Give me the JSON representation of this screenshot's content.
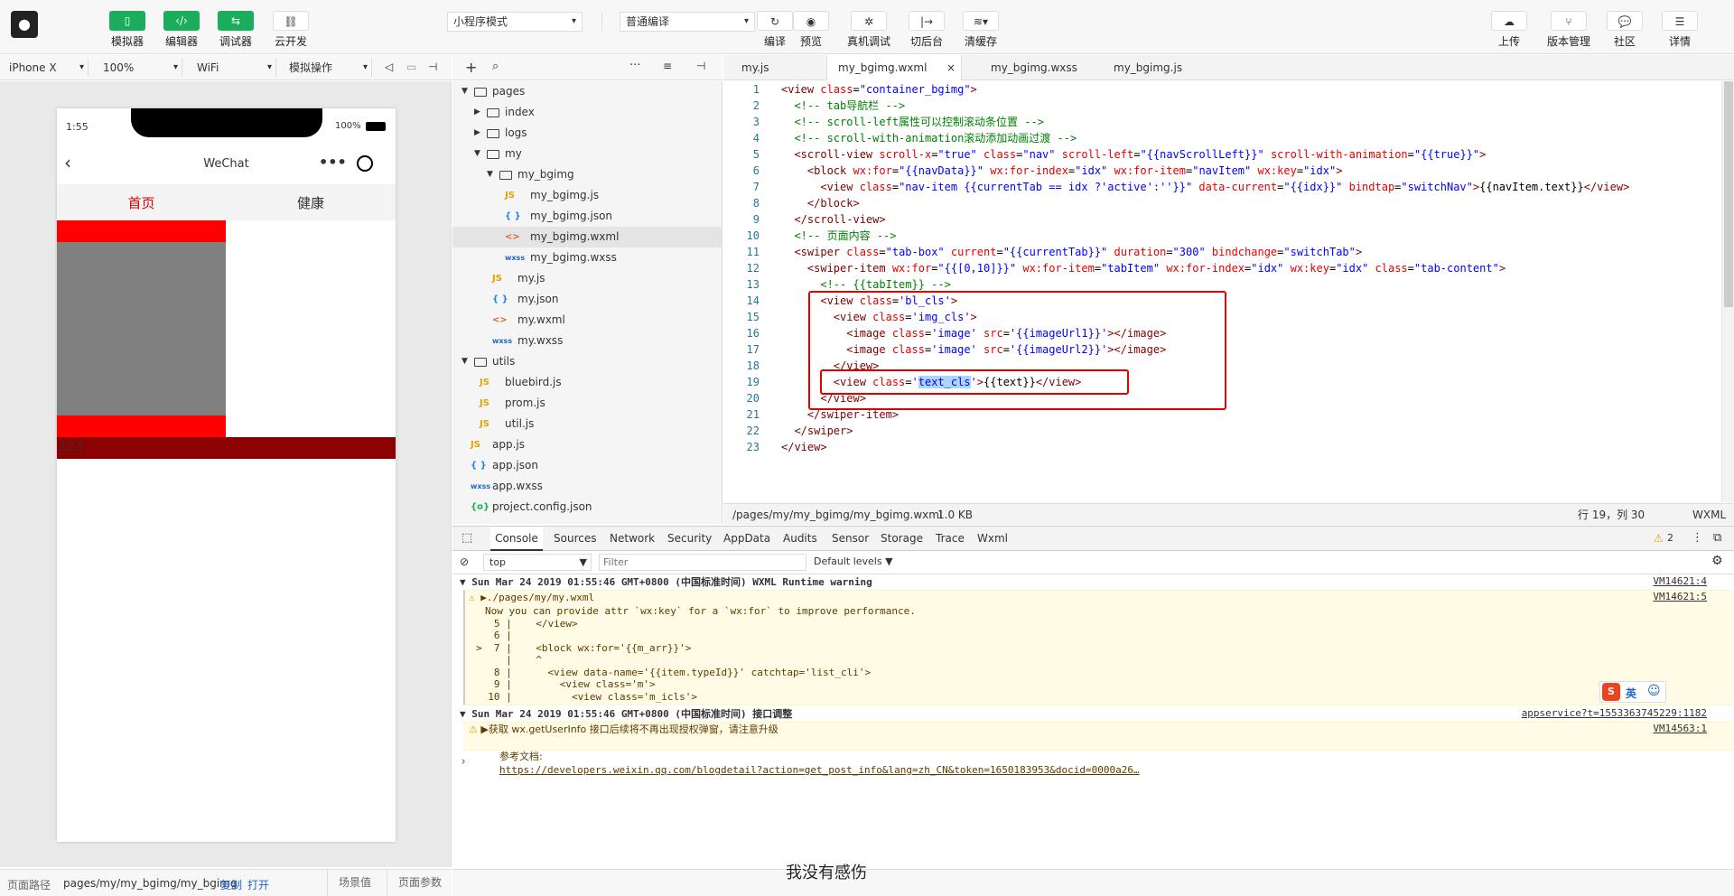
{
  "toolbar": {
    "buttons_left": [
      {
        "label": "模拟器",
        "icon": "phone-icon"
      },
      {
        "label": "编辑器",
        "icon": "code-icon"
      },
      {
        "label": "调试器",
        "icon": "debug-icon"
      },
      {
        "label": "云开发",
        "icon": "cloud-link-icon"
      }
    ],
    "mode_select": "小程序模式",
    "compile_select": "普通编译",
    "buttons_mid": [
      {
        "label": "编译",
        "icon": "refresh-icon"
      },
      {
        "label": "预览",
        "icon": "eye-icon"
      },
      {
        "label": "真机调试",
        "icon": "bug-icon"
      },
      {
        "label": "切后台",
        "icon": "switch-icon"
      },
      {
        "label": "清缓存",
        "icon": "layers-icon"
      }
    ],
    "buttons_right": [
      {
        "label": "上传",
        "icon": "upload-icon"
      },
      {
        "label": "版本管理",
        "icon": "version-icon"
      },
      {
        "label": "社区",
        "icon": "chat-icon"
      },
      {
        "label": "详情",
        "icon": "menu-icon"
      }
    ]
  },
  "simulator": {
    "device": "iPhone X",
    "zoom": "100%",
    "network": "WiFi",
    "operation": "模拟操作",
    "time": "1:55",
    "battery": "100%",
    "nav_title": "WeChat",
    "tabs": [
      "首页",
      "健康"
    ],
    "content_text": "123"
  },
  "footer_left": {
    "path_label": "页面路径",
    "path": "pages/my/my_bgimg/my_bgimg",
    "copy": "复制",
    "open": "打开",
    "scene": "场景值",
    "params": "页面参数"
  },
  "subtitle": "我没有感伤",
  "tree": [
    {
      "name": "pages",
      "type": "folder",
      "depth": 0,
      "open": true
    },
    {
      "name": "index",
      "type": "folder",
      "depth": 1,
      "open": false
    },
    {
      "name": "logs",
      "type": "folder",
      "depth": 1,
      "open": false
    },
    {
      "name": "my",
      "type": "folder",
      "depth": 1,
      "open": true
    },
    {
      "name": "my_bgimg",
      "type": "folder",
      "depth": 2,
      "open": true
    },
    {
      "name": "my_bgimg.js",
      "type": "js",
      "depth": 3
    },
    {
      "name": "my_bgimg.json",
      "type": "json",
      "depth": 3
    },
    {
      "name": "my_bgimg.wxml",
      "type": "wxml",
      "depth": 3,
      "selected": true
    },
    {
      "name": "my_bgimg.wxss",
      "type": "wxss",
      "depth": 3
    },
    {
      "name": "my.js",
      "type": "js",
      "depth": 2
    },
    {
      "name": "my.json",
      "type": "json",
      "depth": 2
    },
    {
      "name": "my.wxml",
      "type": "wxml",
      "depth": 2
    },
    {
      "name": "my.wxss",
      "type": "wxss",
      "depth": 2
    },
    {
      "name": "utils",
      "type": "folder",
      "depth": 0,
      "open": true
    },
    {
      "name": "bluebird.js",
      "type": "js",
      "depth": 1
    },
    {
      "name": "prom.js",
      "type": "js",
      "depth": 1
    },
    {
      "name": "util.js",
      "type": "js",
      "depth": 1
    },
    {
      "name": "app.js",
      "type": "js",
      "depth": 0
    },
    {
      "name": "app.json",
      "type": "json",
      "depth": 0
    },
    {
      "name": "app.wxss",
      "type": "wxss",
      "depth": 0
    },
    {
      "name": "project.config.json",
      "type": "cfg",
      "depth": 0
    }
  ],
  "editor_tabs": [
    "my.js",
    "my_bgimg.wxml",
    "my_bgimg.wxss",
    "my_bgimg.js"
  ],
  "code_lines": [
    "<view class=\"container_bgimg\">",
    "  <!-- tab导航栏 -->",
    "  <!-- scroll-left属性可以控制滚动条位置 -->",
    "  <!-- scroll-with-animation滚动添加动画过渡 -->",
    "  <scroll-view scroll-x=\"true\" class=\"nav\" scroll-left=\"{{navScrollLeft}}\" scroll-with-animation=\"{{true}}\">",
    "    <block wx:for=\"{{navData}}\" wx:for-index=\"idx\" wx:for-item=\"navItem\" wx:key=\"idx\">",
    "      <view class=\"nav-item {{currentTab == idx ?'active':''}}\" data-current=\"{{idx}}\" bindtap=\"switchNav\">{{navItem.text}}</view>",
    "    </block>",
    "  </scroll-view>",
    "  <!-- 页面内容 -->",
    "  <swiper class=\"tab-box\" current=\"{{currentTab}}\" duration=\"300\" bindchange=\"switchTab\">",
    "    <swiper-item wx:for=\"{{[0,10]}}\" wx:for-item=\"tabItem\" wx:for-index=\"idx\" wx:key=\"idx\" class=\"tab-content\">",
    "      <!-- {{tabItem}} -->",
    "      <view class='bl_cls'>",
    "        <view class='img_cls'>",
    "          <image class='image' src='{{imageUrl1}}'></image>",
    "          <image class='image' src='{{imageUrl2}}'></image>",
    "        </view>",
    "        <view class='text_cls'>{{text}}</view>",
    "      </view>",
    "    </swiper-item>",
    "  </swiper>",
    "</view>"
  ],
  "status": {
    "path": "/pages/my/my_bgimg/my_bgimg.wxml",
    "size": "1.0 KB",
    "cursor": "行 19，列 30",
    "lang": "WXML"
  },
  "devtools_tabs": [
    "Console",
    "Sources",
    "Network",
    "Security",
    "AppData",
    "Audits",
    "Sensor",
    "Storage",
    "Trace",
    "Wxml"
  ],
  "warning_count": "2",
  "filter": {
    "context": "top",
    "placeholder": "Filter",
    "levels": "Default levels"
  },
  "console": {
    "group1_title": "Sun Mar 24 2019 01:55:46 GMT+0800 (中国标准时间) WXML Runtime warning",
    "group1_src": "VM14621:4",
    "warn1_file": "./pages/my/my.wxml",
    "warn1_src": "VM14621:5",
    "warn1_lines": [
      "Now you can provide attr `wx:key` for a `wx:for` to improve performance.",
      "   5 |    </view>",
      "   6 |",
      ">  7 |    <block wx:for='{{m_arr}}'>",
      "     |    ^",
      "   8 |      <view data-name='{{item.typeId}}' catchtap='list_cli'>",
      "   9 |        <view class='m'>",
      "  10 |          <view class='m_icls'>"
    ],
    "group2_title": "Sun Mar 24 2019 01:55:46 GMT+0800 (中国标准时间) 接口调整",
    "group2_src": "appservice?t=1553363745229:1182",
    "warn2_text": "获取 wx.getUserInfo 接口后续将不再出现授权弹窗，请注意升级",
    "warn2_src": "VM14563:1",
    "warn2_doc_label": "参考文档:",
    "warn2_doc_link": "https://developers.weixin.qq.com/blogdetail?action=get_post_info&lang=zh_CN&token=1650183953&docid=0000a26…",
    "prompt": "›"
  },
  "ime": {
    "logo": "S",
    "lang": "英"
  }
}
